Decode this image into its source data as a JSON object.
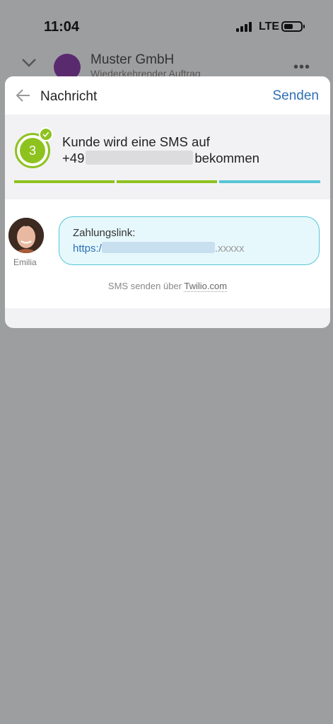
{
  "status_bar": {
    "time": "11:04",
    "network": "LTE"
  },
  "background": {
    "company_name": "Muster GmbH",
    "subtitle": "Wiederkehrender Auftrag",
    "more": "•••"
  },
  "modal": {
    "title": "Nachricht",
    "send_label": "Senden",
    "step": {
      "number": "3",
      "line1": "Kunde wird eine SMS auf",
      "prefix": "+49",
      "suffix": "bekommen"
    },
    "progress_colors": [
      "#8ec21f",
      "#8ec21f",
      "#55c6d6"
    ],
    "message": {
      "sender_name": "Emilia",
      "label": "Zahlungslink:",
      "link_prefix": "https:/",
      "link_suffix": ".xxxxx"
    },
    "powered_by": "SMS senden über",
    "provider": "Twilio.com"
  }
}
